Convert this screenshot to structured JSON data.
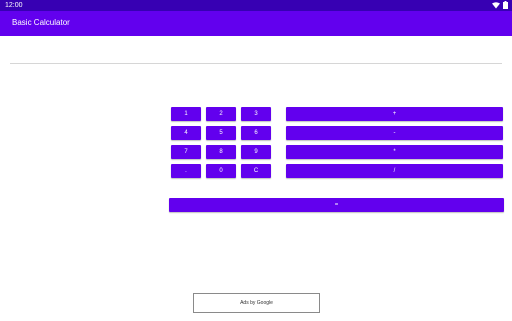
{
  "status_bar": {
    "time": "12:00",
    "icons": [
      "wifi-icon",
      "battery-icon"
    ]
  },
  "app_bar": {
    "title": "Basic Calculator"
  },
  "display": {
    "value": ""
  },
  "keypad": {
    "digits": [
      "1",
      "2",
      "3",
      "4",
      "5",
      "6",
      "7",
      "8",
      "9",
      ".",
      "0",
      "C"
    ],
    "operators": [
      "+",
      "-",
      "*",
      "/"
    ],
    "equals": "="
  },
  "ad": {
    "label": "Ads by Google"
  },
  "colors": {
    "primary": "#6200ee",
    "primary_dark": "#3700b3",
    "background": "#ffffff"
  }
}
